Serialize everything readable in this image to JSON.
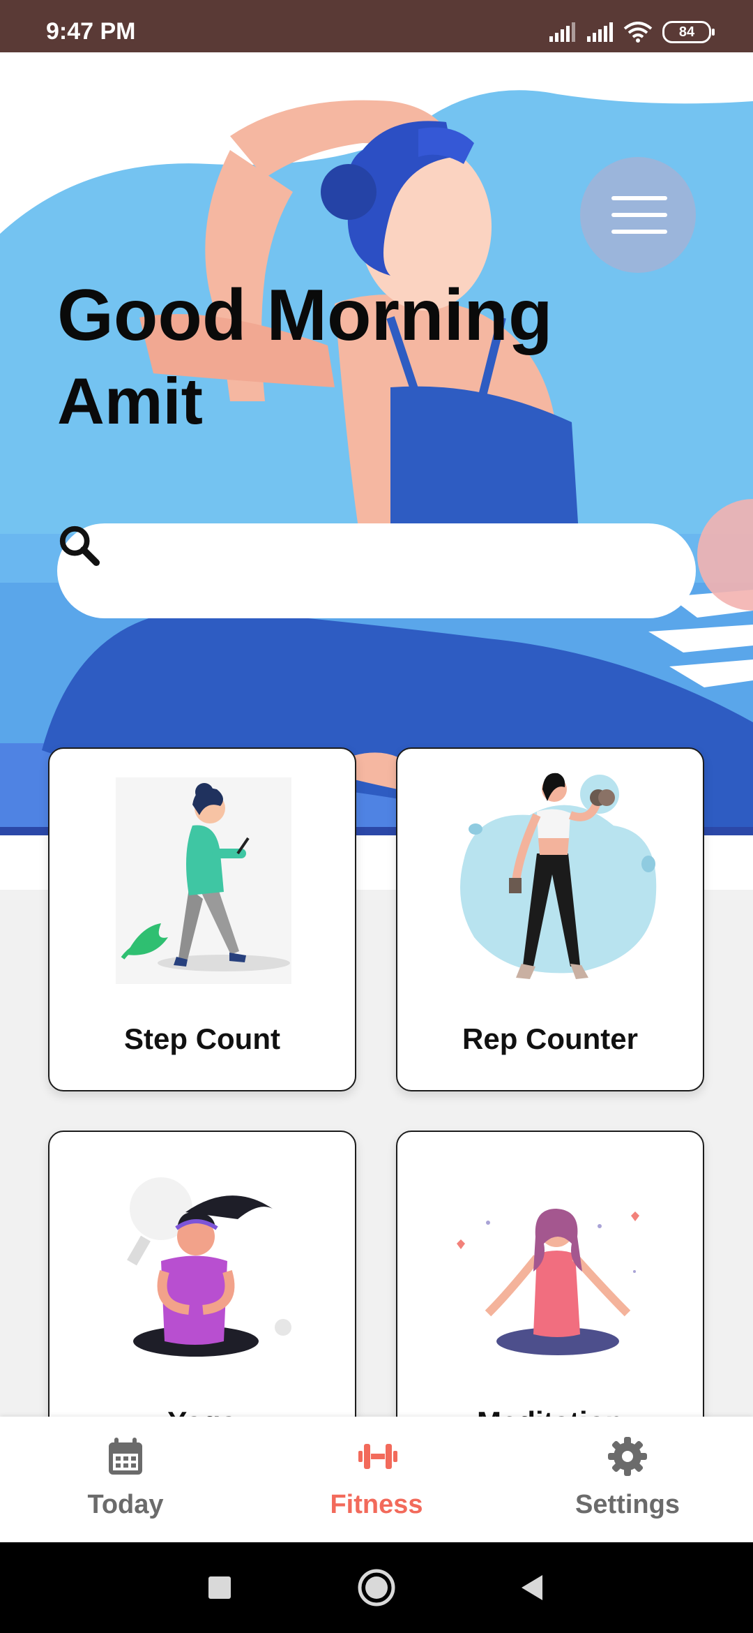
{
  "status_bar": {
    "time": "9:47 PM",
    "battery": "84",
    "icons": [
      "signal-icon",
      "signal-icon",
      "wifi-icon",
      "battery-icon"
    ]
  },
  "header": {
    "greeting": "Good Morning",
    "name": "Amit",
    "menu_icon": "hamburger-menu-icon"
  },
  "search": {
    "placeholder": "",
    "value": "",
    "icon": "search-icon"
  },
  "cards": [
    {
      "label": "Step Count",
      "illustration": "walking-person"
    },
    {
      "label": "Rep Counter",
      "illustration": "dumbbell-woman"
    },
    {
      "label": "Yoga",
      "illustration": "yoga-woman"
    },
    {
      "label": "Meditation",
      "illustration": "meditating-woman"
    }
  ],
  "bottom_nav": {
    "items": [
      {
        "label": "Today",
        "icon": "calendar-icon",
        "active": false
      },
      {
        "label": "Fitness",
        "icon": "dumbbell-icon",
        "active": true
      },
      {
        "label": "Settings",
        "icon": "gear-icon",
        "active": false
      }
    ]
  },
  "colors": {
    "accent": "#f26a5b",
    "inactive": "#6b6b6b",
    "status_bar": "#5a3a36",
    "hero_sky": "#74c3f1",
    "hero_body": "#2e5cc2"
  }
}
